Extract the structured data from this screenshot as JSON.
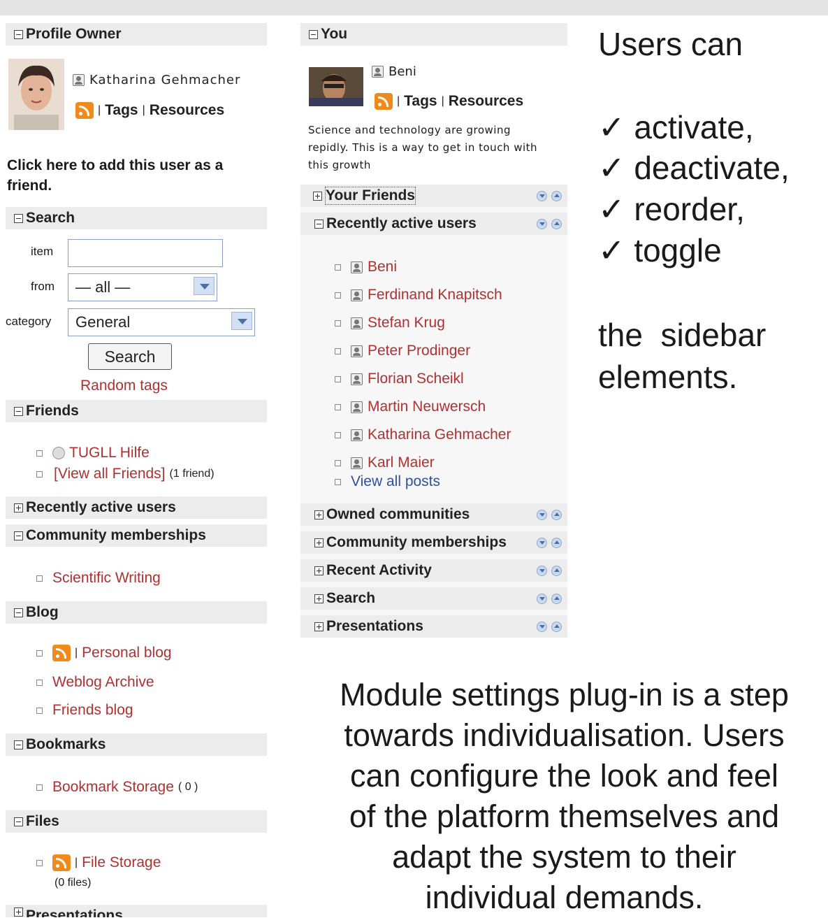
{
  "left": {
    "profile_header": "Profile Owner",
    "owner_name": "Katharina Gehmacher",
    "tags_label": "Tags",
    "resources_label": "Resources",
    "add_friend": "Click here to add this user as a friend.",
    "search_header": "Search",
    "item_label": "item",
    "from_label": "from",
    "from_value": "— all —",
    "category_label": "category",
    "category_value": "General",
    "search_button": "Search",
    "random_tags": "Random tags",
    "friends_header": "Friends",
    "friend_1": "TUGLL Hilfe",
    "view_all_friends": "[View all Friends]",
    "friend_count": "(1 friend)",
    "recent_header": "Recently active users",
    "community_header": "Community memberships",
    "community_1": "Scientific Writing",
    "blog_header": "Blog",
    "personal_blog": "Personal blog",
    "weblog_archive": "Weblog Archive",
    "friends_blog": "Friends blog",
    "bookmarks_header": "Bookmarks",
    "bookmark_storage": "Bookmark Storage",
    "bookmark_count": "( 0 )",
    "files_header": "Files",
    "file_storage": "File Storage",
    "file_count": "(0 files)",
    "presentations_header": "Presentations"
  },
  "mid": {
    "you_header": "You",
    "you_name": "Beni",
    "tags_label": "Tags",
    "resources_label": "Resources",
    "bio": "Science and technology are growing repidly. This is a way to get in touch with this growth",
    "your_friends": "Your Friends",
    "recent_header": "Recently active users",
    "users": [
      "Beni",
      "Ferdinand Knapitsch",
      "Stefan Krug",
      "Peter Prodinger",
      "Florian Scheikl",
      "Martin Neuwersch",
      "Katharina Gehmacher",
      "Karl Maier"
    ],
    "view_all_posts": "View all posts",
    "owned_communities": "Owned communities",
    "community_memberships": "Community memberships",
    "recent_activity": "Recent Activity",
    "search": "Search",
    "presentations": "Presentations"
  },
  "right": {
    "users_can": "Users can",
    "items": [
      "✓ activate,",
      "✓ deactivate,",
      "✓ reorder,",
      "✓ toggle"
    ],
    "line1": "the  sidebar",
    "line2": "elements.",
    "bottom": [
      "Module settings plug-in is a step",
      "towards individualisation. Users",
      "can configure the look and feel",
      "of the platform themselves and",
      "adapt the system to their",
      "individual demands."
    ]
  },
  "colors": {
    "link": "#b03030",
    "header_bg": "#ececec",
    "accent_red": "#a61b1b"
  }
}
